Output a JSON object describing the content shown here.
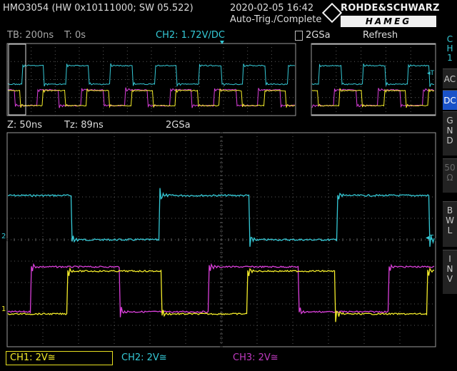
{
  "header": {
    "model": "HMO3054 (HW 0x10111000; SW 05.522)",
    "datetime": "2020-02-05 16:42",
    "trigger_status": "Auto-Trig./Complete",
    "logo_top": "ROHDE&SCHWARZ",
    "logo_bottom": "HAMEG"
  },
  "info_bar": {
    "timebase": "TB: 200ns",
    "trigger_time": "T: 0s",
    "trigger_source": "CH2: 1.72V",
    "trigger_coupling": "/DC",
    "sample_rate": "2GSa",
    "acquire_mode": "Refresh"
  },
  "zoom_bar": {
    "zoom": "Z: 50ns",
    "zoom_time": "Tz: 89ns",
    "sample_rate": "2GSa"
  },
  "side_menu": {
    "channel_label": [
      "C",
      "H",
      "1"
    ],
    "buttons": [
      {
        "label": [
          "AC"
        ],
        "active": false
      },
      {
        "label": [
          "DC"
        ],
        "active": true
      },
      {
        "label": [
          "G",
          "N",
          "D"
        ],
        "active": false
      },
      {
        "label": [
          "50",
          "Ω"
        ],
        "active": false,
        "disabled": true
      },
      {
        "label": [
          "B",
          "W",
          "L"
        ],
        "active": false
      },
      {
        "label": [
          "I",
          "N",
          "V"
        ],
        "active": false
      }
    ]
  },
  "footer": {
    "ch1": "CH1: 2V≅",
    "ch2": "CH2: 2V≅",
    "ch3": "CH3: 2V≅"
  },
  "markers": {
    "trigger_marker": "T",
    "ch2_ref": "2",
    "ch1_ref": "1"
  },
  "colors": {
    "ch1": "#f4ec2a",
    "ch2": "#35c9d6",
    "ch3": "#d93fd9",
    "grid": "#5a5a5a",
    "frame": "#9a9a9a",
    "active_button": "#1a52c8"
  }
}
